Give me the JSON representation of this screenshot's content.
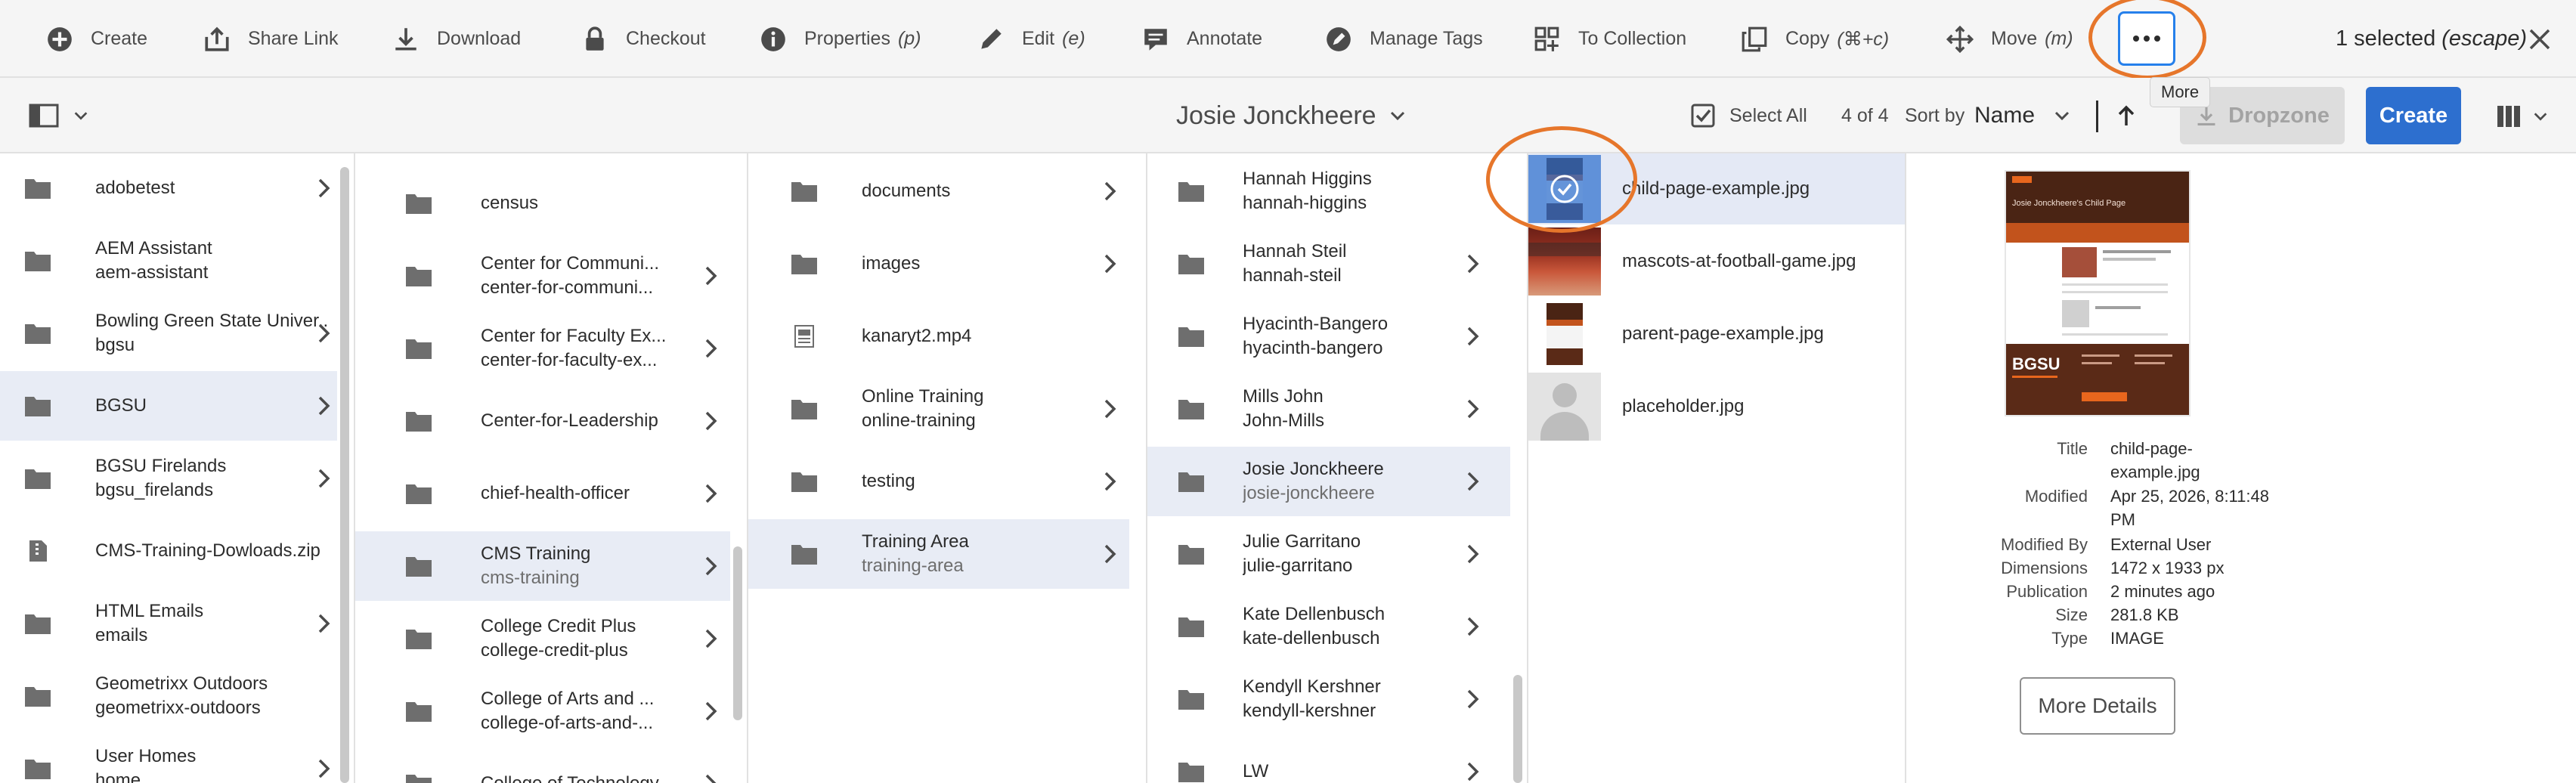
{
  "toolbar": {
    "create": "Create",
    "share_link": "Share Link",
    "download": "Download",
    "checkout": "Checkout",
    "properties": "Properties",
    "properties_key": "(p)",
    "edit": "Edit",
    "edit_key": "(e)",
    "annotate": "Annotate",
    "manage_tags": "Manage Tags",
    "to_collection": "To Collection",
    "copy": "Copy",
    "copy_key": "(⌘+c)",
    "move": "Move",
    "move_key": "(m)",
    "more_tooltip": "More",
    "selected_count": "1 selected",
    "selected_escape": "(escape)"
  },
  "header": {
    "title": "Josie Jonckheere",
    "select_all": "Select All",
    "count": "4 of 4",
    "sort_by": "Sort by",
    "sort_value": "Name",
    "dropzone": "Dropzone",
    "create": "Create"
  },
  "columns": [
    {
      "items": [
        {
          "title": "adobetest",
          "sub": "",
          "icon": "folder-icon",
          "chevron": true,
          "selected": false
        },
        {
          "title": "AEM Assistant",
          "sub": "aem-assistant",
          "icon": "folder-icon",
          "chevron": false,
          "selected": false
        },
        {
          "title": "Bowling Green State Univer...",
          "sub": "bgsu",
          "icon": "folder-icon",
          "chevron": true,
          "selected": false
        },
        {
          "title": "BGSU",
          "sub": "",
          "icon": "folder-icon",
          "chevron": true,
          "selected": true
        },
        {
          "title": "BGSU Firelands",
          "sub": "bgsu_firelands",
          "icon": "folder-icon",
          "chevron": true,
          "selected": false
        },
        {
          "title": "CMS-Training-Dowloads.zip",
          "sub": "",
          "icon": "file-icon",
          "chevron": false,
          "selected": false
        },
        {
          "title": "HTML Emails",
          "sub": "emails",
          "icon": "folder-icon",
          "chevron": true,
          "selected": false
        },
        {
          "title": "Geometrixx Outdoors",
          "sub": "geometrixx-outdoors",
          "icon": "folder-icon",
          "chevron": false,
          "selected": false
        },
        {
          "title": "User Homes",
          "sub": "home",
          "icon": "folder-icon",
          "chevron": true,
          "selected": false
        }
      ]
    },
    {
      "items": [
        {
          "title": "census",
          "sub": "",
          "icon": "folder-icon",
          "chevron": false,
          "selected": false
        },
        {
          "title": "Center for Communi...",
          "sub": "center-for-communi...",
          "icon": "folder-icon",
          "chevron": true,
          "selected": false
        },
        {
          "title": "Center for Faculty Ex...",
          "sub": "center-for-faculty-ex...",
          "icon": "folder-icon",
          "chevron": true,
          "selected": false
        },
        {
          "title": "Center-for-Leadership",
          "sub": "",
          "icon": "folder-icon",
          "chevron": true,
          "selected": false
        },
        {
          "title": "chief-health-officer",
          "sub": "",
          "icon": "folder-icon",
          "chevron": true,
          "selected": false
        },
        {
          "title": "CMS Training",
          "sub": "cms-training",
          "icon": "folder-icon",
          "chevron": true,
          "selected": true
        },
        {
          "title": "College Credit Plus",
          "sub": "college-credit-plus",
          "icon": "folder-icon",
          "chevron": true,
          "selected": false
        },
        {
          "title": "College of Arts and ...",
          "sub": "college-of-arts-and-...",
          "icon": "folder-icon",
          "chevron": true,
          "selected": false
        },
        {
          "title": "College of Technology",
          "sub": "",
          "icon": "folder-icon",
          "chevron": true,
          "selected": false
        }
      ]
    },
    {
      "items": [
        {
          "title": "documents",
          "sub": "",
          "icon": "folder-icon",
          "chevron": true,
          "selected": false
        },
        {
          "title": "images",
          "sub": "",
          "icon": "folder-icon",
          "chevron": true,
          "selected": false
        },
        {
          "title": "kanaryt2.mp4",
          "sub": "",
          "icon": "video-file-icon",
          "chevron": false,
          "selected": false
        },
        {
          "title": "Online Training",
          "sub": "online-training",
          "icon": "folder-icon",
          "chevron": true,
          "selected": false
        },
        {
          "title": "testing",
          "sub": "",
          "icon": "folder-icon",
          "chevron": true,
          "selected": false
        },
        {
          "title": "Training Area",
          "sub": "training-area",
          "icon": "folder-icon",
          "chevron": true,
          "selected": true
        }
      ]
    },
    {
      "items": [
        {
          "title": "Hannah Higgins",
          "sub": "hannah-higgins",
          "icon": "folder-icon",
          "chevron": false,
          "selected": false
        },
        {
          "title": "Hannah Steil",
          "sub": "hannah-steil",
          "icon": "folder-icon",
          "chevron": true,
          "selected": false
        },
        {
          "title": "Hyacinth-Bangero",
          "sub": "hyacinth-bangero",
          "icon": "folder-icon",
          "chevron": true,
          "selected": false
        },
        {
          "title": "Mills John",
          "sub": "John-Mills",
          "icon": "folder-icon",
          "chevron": true,
          "selected": false
        },
        {
          "title": "Josie Jonckheere",
          "sub": "josie-jonckheere",
          "icon": "folder-icon",
          "chevron": true,
          "selected": true
        },
        {
          "title": "Julie Garritano",
          "sub": "julie-garritano",
          "icon": "folder-icon",
          "chevron": true,
          "selected": false
        },
        {
          "title": "Kate Dellenbusch",
          "sub": "kate-dellenbusch",
          "icon": "folder-icon",
          "chevron": true,
          "selected": false
        },
        {
          "title": "Kendyll Kershner",
          "sub": "kendyll-kershner",
          "icon": "folder-icon",
          "chevron": true,
          "selected": false
        },
        {
          "title": "LW",
          "sub": "",
          "icon": "folder-icon",
          "chevron": true,
          "selected": false
        }
      ]
    }
  ],
  "assets": [
    {
      "name": "child-page-example.jpg",
      "thumb": "page-thumbnail",
      "selected": true
    },
    {
      "name": "mascots-at-football-game.jpg",
      "thumb": "photo-thumbnail",
      "selected": false
    },
    {
      "name": "parent-page-example.jpg",
      "thumb": "page-thumbnail",
      "selected": false
    },
    {
      "name": "placeholder.jpg",
      "thumb": "avatar-placeholder-thumbnail",
      "selected": false
    }
  ],
  "preview": {
    "brand": "BGSU",
    "page_heading": "Josie Jonckheere's Child Page",
    "metadata": [
      {
        "key": "Title",
        "value": "child-page-example.jpg"
      },
      {
        "key": "Modified",
        "value": "Apr 25, 2026, 8:11:48 PM"
      },
      {
        "key": "Modified By",
        "value": "External User"
      },
      {
        "key": "Dimensions",
        "value": "1472 x 1933 px"
      },
      {
        "key": "Publication",
        "value": "2 minutes ago"
      },
      {
        "key": "Size",
        "value": "281.8 KB"
      },
      {
        "key": "Type",
        "value": "IMAGE"
      }
    ],
    "more_details": "More Details"
  },
  "colors": {
    "accent": "#2d6fcf",
    "focus": "#2680eb",
    "highlight_ring": "#e6762b",
    "selected_row": "#e8ecf5",
    "brand_dark": "#4a2414",
    "brand_orange": "#e8661d"
  }
}
